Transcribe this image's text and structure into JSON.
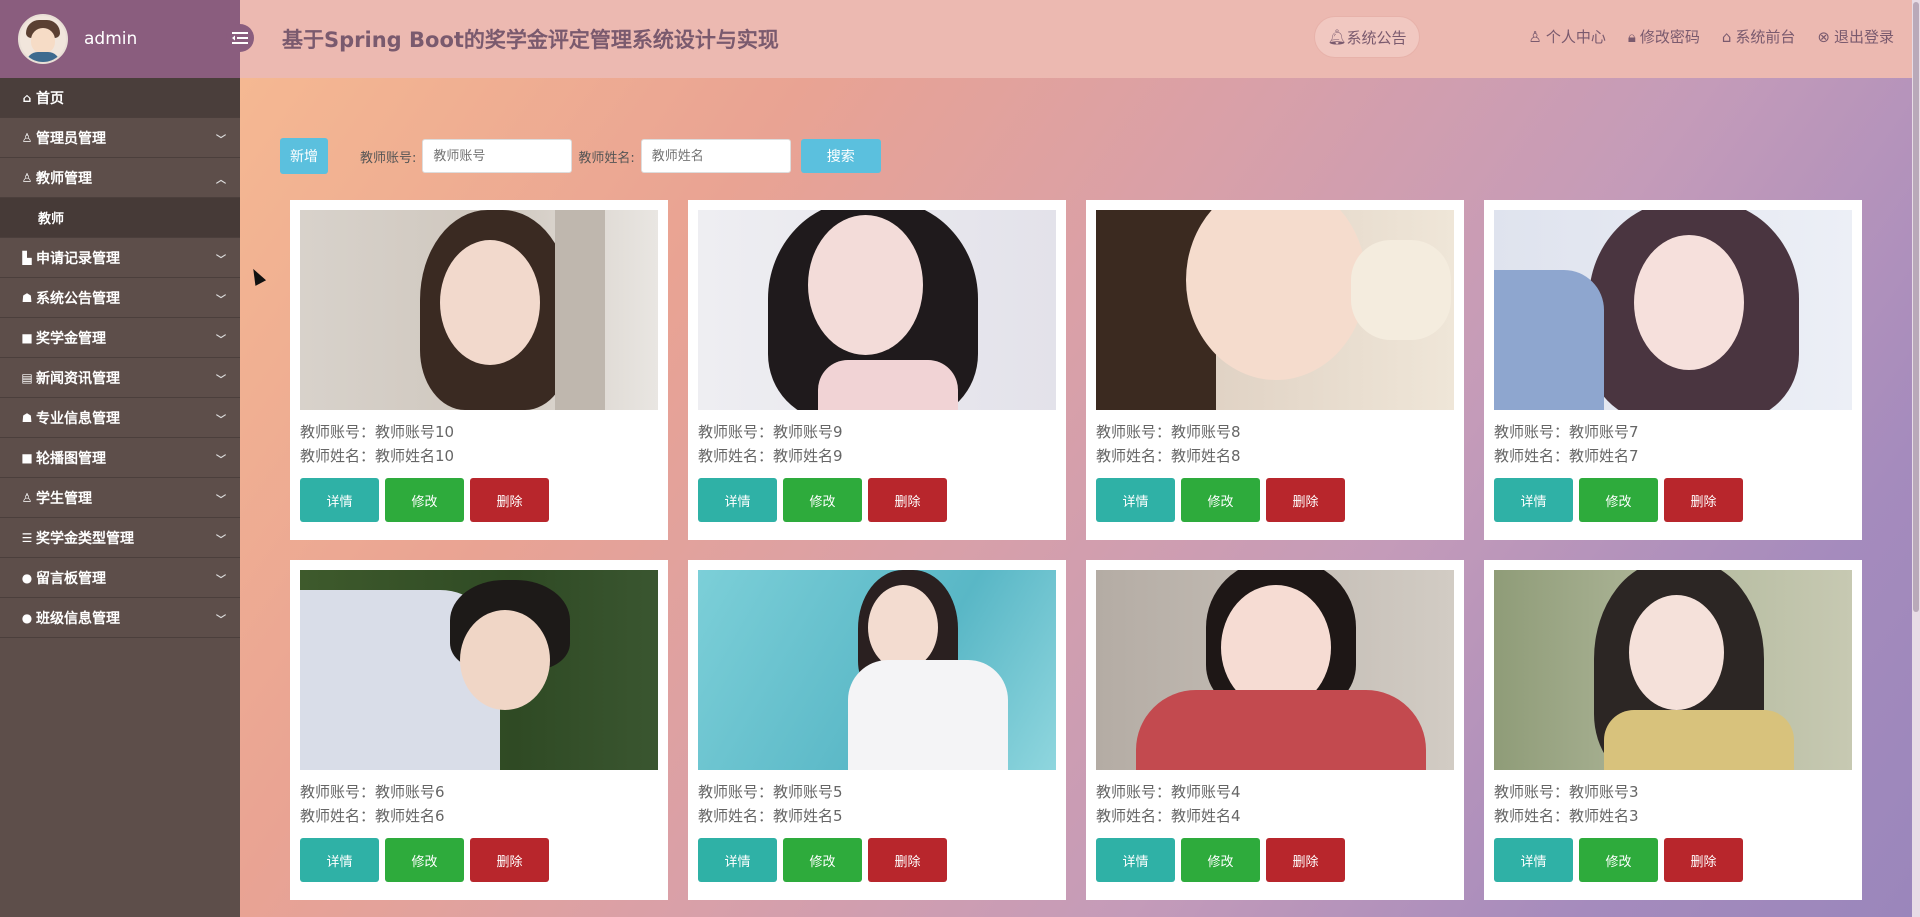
{
  "sidebar": {
    "username": "admin",
    "items": [
      {
        "label": "首页",
        "icon": "home-icon"
      },
      {
        "label": "管理员管理",
        "icon": "user-shield-icon"
      },
      {
        "label": "教师管理",
        "icon": "teacher-icon"
      },
      {
        "label": "教师",
        "icon": ""
      },
      {
        "label": "申请记录管理",
        "icon": "file-icon"
      },
      {
        "label": "系统公告管理",
        "icon": "bullhorn-icon"
      },
      {
        "label": "奖学金管理",
        "icon": "square-icon"
      },
      {
        "label": "新闻资讯管理",
        "icon": "newspaper-icon"
      },
      {
        "label": "专业信息管理",
        "icon": "graduation-icon"
      },
      {
        "label": "轮播图管理",
        "icon": "image-icon"
      },
      {
        "label": "学生管理",
        "icon": "student-icon"
      },
      {
        "label": "奖学金类型管理",
        "icon": "list-icon"
      },
      {
        "label": "留言板管理",
        "icon": "message-icon"
      },
      {
        "label": "班级信息管理",
        "icon": "class-icon"
      }
    ]
  },
  "header": {
    "title": "基于Spring Boot的奖学金评定管理系统设计与实现",
    "notice": "系统公告",
    "links": [
      "个人中心",
      "修改密码",
      "系统前台",
      "退出登录"
    ]
  },
  "toolbar": {
    "new_label": "新增",
    "account_label": "教师账号:",
    "account_placeholder": "教师账号",
    "name_label": "教师姓名:",
    "name_placeholder": "教师姓名",
    "search_label": "搜索"
  },
  "cards": [
    {
      "account": "教师账号：教师账号10",
      "name": "教师姓名：教师姓名10"
    },
    {
      "account": "教师账号：教师账号9",
      "name": "教师姓名：教师姓名9"
    },
    {
      "account": "教师账号：教师账号8",
      "name": "教师姓名：教师姓名8"
    },
    {
      "account": "教师账号：教师账号7",
      "name": "教师姓名：教师姓名7"
    },
    {
      "account": "教师账号：教师账号6",
      "name": "教师姓名：教师姓名6"
    },
    {
      "account": "教师账号：教师账号5",
      "name": "教师姓名：教师姓名5"
    },
    {
      "account": "教师账号：教师账号4",
      "name": "教师姓名：教师姓名4"
    },
    {
      "account": "教师账号：教师账号3",
      "name": "教师姓名：教师姓名3"
    }
  ],
  "card_actions": {
    "detail": "详情",
    "edit": "修改",
    "delete": "删除"
  },
  "colors": {
    "sidebar": "#5d4e4a",
    "topbar": "#ecb9b1",
    "detail": "#2fb1a6",
    "edit": "#2eab3c",
    "delete": "#b8262c",
    "accent": "#5bc0de"
  }
}
